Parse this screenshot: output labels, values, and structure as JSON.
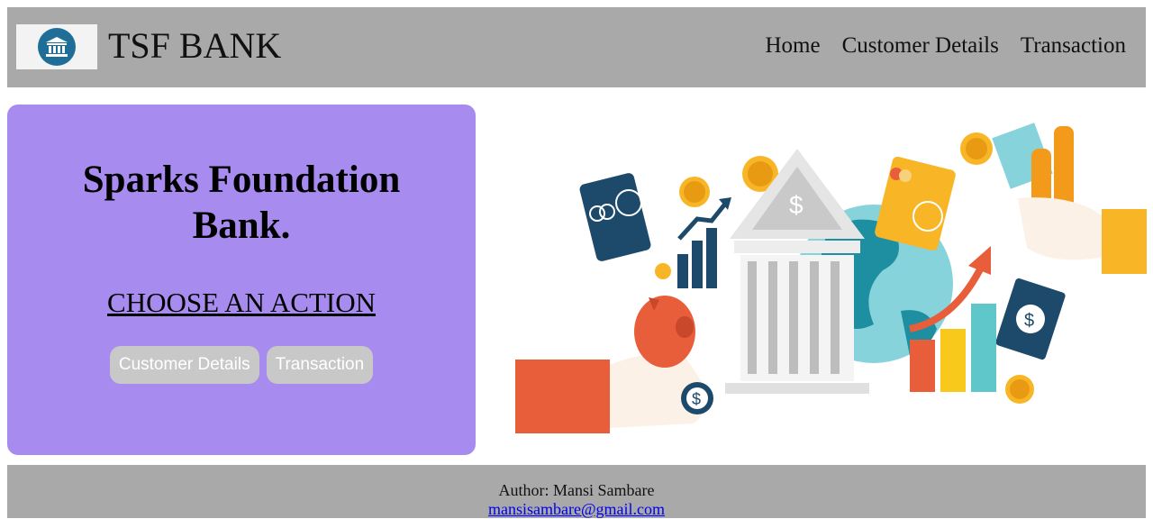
{
  "header": {
    "brand": "TSF BANK",
    "logo_icon": "bank-building-icon",
    "nav": [
      "Home",
      "Customer Details",
      "Transaction"
    ]
  },
  "hero": {
    "title": "Sparks Foundation Bank.",
    "subtitle": "CHOOSE AN ACTION",
    "buttons": [
      "Customer Details",
      "Transaction"
    ]
  },
  "illustration": {
    "icon": "banking-finance-illustration"
  },
  "footer": {
    "author": "Author: Mansi Sambare",
    "email": "mansisambare@gmail.com"
  },
  "colors": {
    "header_bg": "#a9a9a9",
    "hero_bg": "#a78bef",
    "button_bg": "#c8c8c8",
    "logo_circle": "#1f6e97"
  }
}
